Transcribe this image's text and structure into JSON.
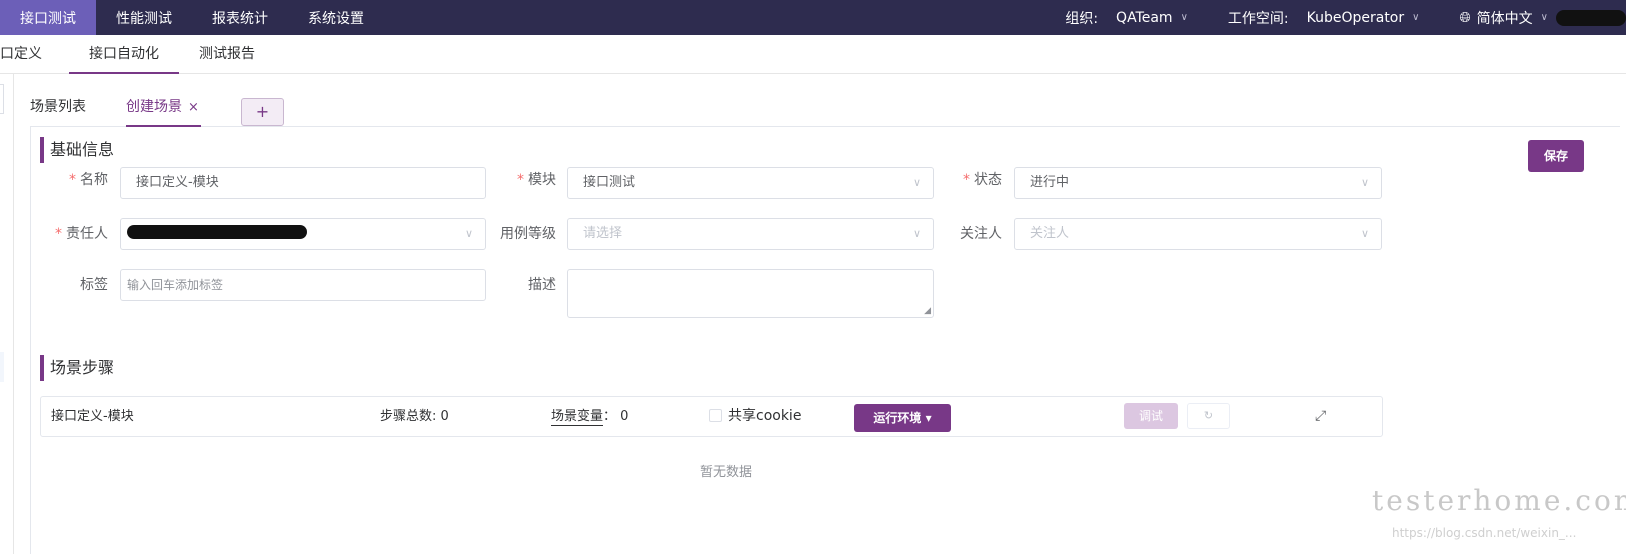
{
  "topnav": {
    "tabs": [
      {
        "label": "接口测试",
        "active": true
      },
      {
        "label": "性能测试",
        "active": false
      },
      {
        "label": "报表统计",
        "active": false
      },
      {
        "label": "系统设置",
        "active": false
      }
    ],
    "org_label": "组织:",
    "org_value": "QATeam",
    "workspace_label": "工作空间:",
    "workspace_value": "KubeOperator",
    "language": "简体中文"
  },
  "subnav": {
    "tabs": [
      {
        "label": "接口定义",
        "active": false
      },
      {
        "label": "接口自动化",
        "active": true
      },
      {
        "label": "测试报告",
        "active": false
      }
    ]
  },
  "scene_tabs": {
    "list_label": "场景列表",
    "active_label": "创建场景",
    "close_glyph": "×",
    "add_glyph": "+"
  },
  "basic": {
    "title": "基础信息",
    "save_label": "保存",
    "name_label": "名称",
    "name_value": "接口定义-模块",
    "module_label": "模块",
    "module_value": "接口测试",
    "status_label": "状态",
    "status_value": "进行中",
    "owner_label": "责任人",
    "level_label": "用例等级",
    "level_placeholder": "请选择",
    "follower_label": "关注人",
    "follower_placeholder": "关注人",
    "tag_label": "标签",
    "tag_placeholder": "输入回车添加标签",
    "desc_label": "描述"
  },
  "steps": {
    "title": "场景步骤",
    "scene_name": "接口定义-模块",
    "total_label": "步骤总数:",
    "total_value": "0",
    "var_label": "场景变量",
    "var_value": "0",
    "share_cookie_label": "共享cookie",
    "share_cookie_checked": false,
    "env_label": "运行环境",
    "debug_label": "调试",
    "empty_text": "暂无数据"
  },
  "watermark": {
    "text": "testerhome.com",
    "url": "https://blog.csdn.net/weixin_..."
  },
  "colors": {
    "topbar": "#2e2c4f",
    "active_tab": "#6c5fb8",
    "accent": "#783887",
    "required": "#f56c6c"
  }
}
